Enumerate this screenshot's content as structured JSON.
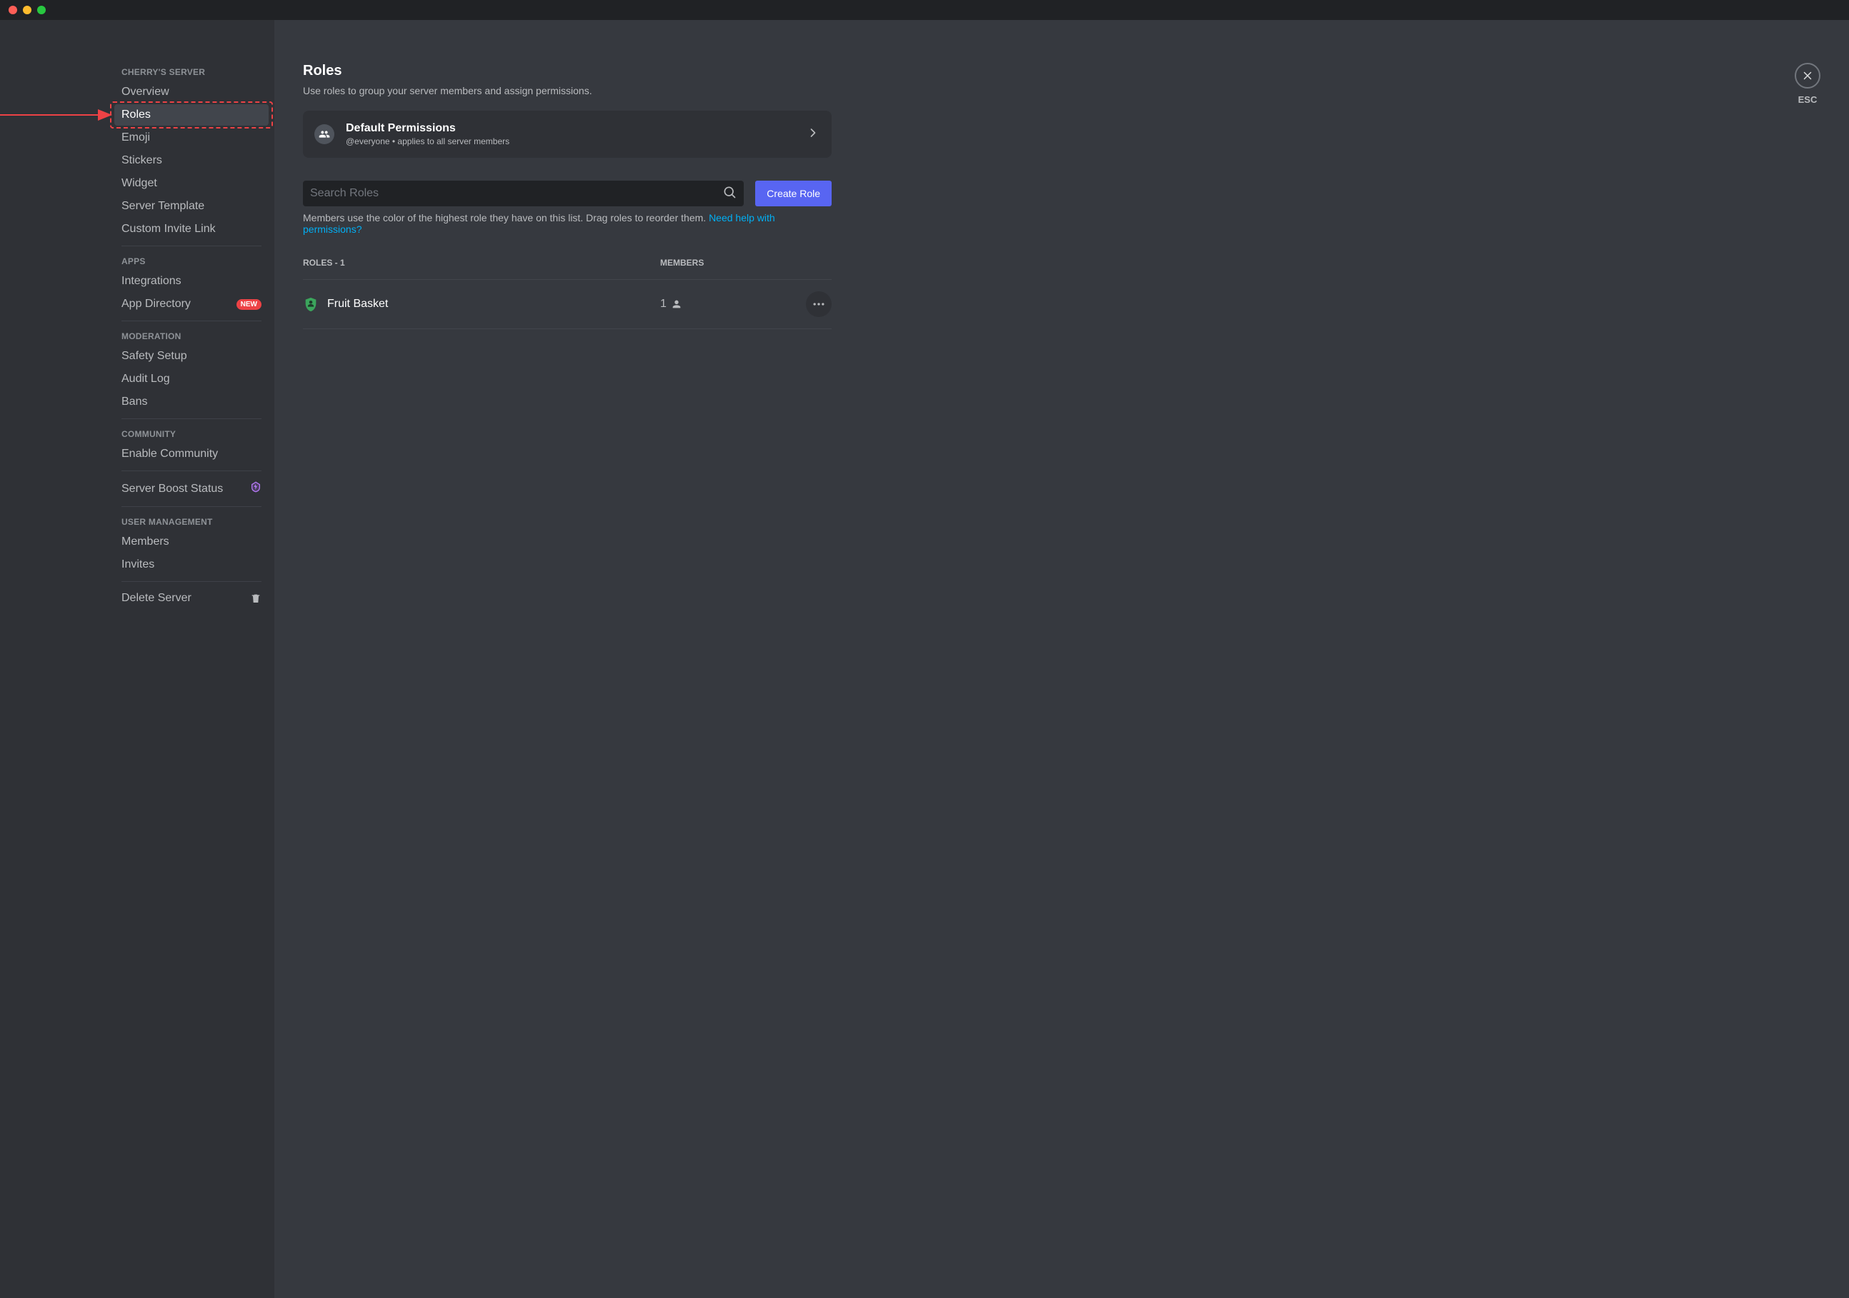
{
  "sidebar": {
    "server_name_header": "Cherry's Server",
    "items_main": [
      {
        "label": "Overview"
      },
      {
        "label": "Roles"
      },
      {
        "label": "Emoji"
      },
      {
        "label": "Stickers"
      },
      {
        "label": "Widget"
      },
      {
        "label": "Server Template"
      },
      {
        "label": "Custom Invite Link"
      }
    ],
    "apps_header": "Apps",
    "items_apps": [
      {
        "label": "Integrations"
      },
      {
        "label": "App Directory",
        "badge": "New"
      }
    ],
    "moderation_header": "Moderation",
    "items_moderation": [
      {
        "label": "Safety Setup"
      },
      {
        "label": "Audit Log"
      },
      {
        "label": "Bans"
      }
    ],
    "community_header": "Community",
    "items_community": [
      {
        "label": "Enable Community"
      }
    ],
    "boost_label": "Server Boost Status",
    "user_mgmt_header": "User Management",
    "items_user_mgmt": [
      {
        "label": "Members"
      },
      {
        "label": "Invites"
      }
    ],
    "delete_label": "Delete Server"
  },
  "close": {
    "label": "ESC"
  },
  "main": {
    "title": "Roles",
    "subtitle": "Use roles to group your server members and assign permissions.",
    "default_perms": {
      "title": "Default Permissions",
      "subtitle": "@everyone • applies to all server members"
    },
    "search": {
      "placeholder": "Search Roles"
    },
    "create_button": "Create Role",
    "hint_text": "Members use the color of the highest role they have on this list. Drag roles to reorder them. ",
    "hint_link": "Need help with permissions?",
    "roles_count_header": "Roles - 1",
    "members_header": "Members",
    "roles": [
      {
        "name": "Fruit Basket",
        "member_count": "1",
        "color": "#3ba55c"
      }
    ]
  }
}
